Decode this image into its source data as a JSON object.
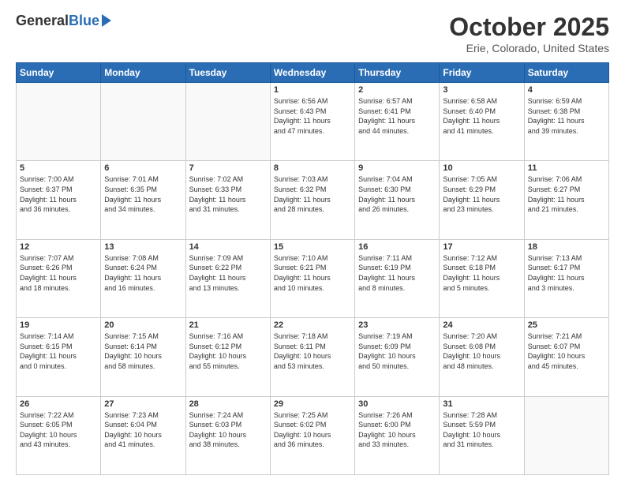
{
  "header": {
    "logo_general": "General",
    "logo_blue": "Blue",
    "month_title": "October 2025",
    "location": "Erie, Colorado, United States"
  },
  "days_of_week": [
    "Sunday",
    "Monday",
    "Tuesday",
    "Wednesday",
    "Thursday",
    "Friday",
    "Saturday"
  ],
  "weeks": [
    [
      {
        "day": "",
        "info": ""
      },
      {
        "day": "",
        "info": ""
      },
      {
        "day": "",
        "info": ""
      },
      {
        "day": "1",
        "info": "Sunrise: 6:56 AM\nSunset: 6:43 PM\nDaylight: 11 hours\nand 47 minutes."
      },
      {
        "day": "2",
        "info": "Sunrise: 6:57 AM\nSunset: 6:41 PM\nDaylight: 11 hours\nand 44 minutes."
      },
      {
        "day": "3",
        "info": "Sunrise: 6:58 AM\nSunset: 6:40 PM\nDaylight: 11 hours\nand 41 minutes."
      },
      {
        "day": "4",
        "info": "Sunrise: 6:59 AM\nSunset: 6:38 PM\nDaylight: 11 hours\nand 39 minutes."
      }
    ],
    [
      {
        "day": "5",
        "info": "Sunrise: 7:00 AM\nSunset: 6:37 PM\nDaylight: 11 hours\nand 36 minutes."
      },
      {
        "day": "6",
        "info": "Sunrise: 7:01 AM\nSunset: 6:35 PM\nDaylight: 11 hours\nand 34 minutes."
      },
      {
        "day": "7",
        "info": "Sunrise: 7:02 AM\nSunset: 6:33 PM\nDaylight: 11 hours\nand 31 minutes."
      },
      {
        "day": "8",
        "info": "Sunrise: 7:03 AM\nSunset: 6:32 PM\nDaylight: 11 hours\nand 28 minutes."
      },
      {
        "day": "9",
        "info": "Sunrise: 7:04 AM\nSunset: 6:30 PM\nDaylight: 11 hours\nand 26 minutes."
      },
      {
        "day": "10",
        "info": "Sunrise: 7:05 AM\nSunset: 6:29 PM\nDaylight: 11 hours\nand 23 minutes."
      },
      {
        "day": "11",
        "info": "Sunrise: 7:06 AM\nSunset: 6:27 PM\nDaylight: 11 hours\nand 21 minutes."
      }
    ],
    [
      {
        "day": "12",
        "info": "Sunrise: 7:07 AM\nSunset: 6:26 PM\nDaylight: 11 hours\nand 18 minutes."
      },
      {
        "day": "13",
        "info": "Sunrise: 7:08 AM\nSunset: 6:24 PM\nDaylight: 11 hours\nand 16 minutes."
      },
      {
        "day": "14",
        "info": "Sunrise: 7:09 AM\nSunset: 6:22 PM\nDaylight: 11 hours\nand 13 minutes."
      },
      {
        "day": "15",
        "info": "Sunrise: 7:10 AM\nSunset: 6:21 PM\nDaylight: 11 hours\nand 10 minutes."
      },
      {
        "day": "16",
        "info": "Sunrise: 7:11 AM\nSunset: 6:19 PM\nDaylight: 11 hours\nand 8 minutes."
      },
      {
        "day": "17",
        "info": "Sunrise: 7:12 AM\nSunset: 6:18 PM\nDaylight: 11 hours\nand 5 minutes."
      },
      {
        "day": "18",
        "info": "Sunrise: 7:13 AM\nSunset: 6:17 PM\nDaylight: 11 hours\nand 3 minutes."
      }
    ],
    [
      {
        "day": "19",
        "info": "Sunrise: 7:14 AM\nSunset: 6:15 PM\nDaylight: 11 hours\nand 0 minutes."
      },
      {
        "day": "20",
        "info": "Sunrise: 7:15 AM\nSunset: 6:14 PM\nDaylight: 10 hours\nand 58 minutes."
      },
      {
        "day": "21",
        "info": "Sunrise: 7:16 AM\nSunset: 6:12 PM\nDaylight: 10 hours\nand 55 minutes."
      },
      {
        "day": "22",
        "info": "Sunrise: 7:18 AM\nSunset: 6:11 PM\nDaylight: 10 hours\nand 53 minutes."
      },
      {
        "day": "23",
        "info": "Sunrise: 7:19 AM\nSunset: 6:09 PM\nDaylight: 10 hours\nand 50 minutes."
      },
      {
        "day": "24",
        "info": "Sunrise: 7:20 AM\nSunset: 6:08 PM\nDaylight: 10 hours\nand 48 minutes."
      },
      {
        "day": "25",
        "info": "Sunrise: 7:21 AM\nSunset: 6:07 PM\nDaylight: 10 hours\nand 45 minutes."
      }
    ],
    [
      {
        "day": "26",
        "info": "Sunrise: 7:22 AM\nSunset: 6:05 PM\nDaylight: 10 hours\nand 43 minutes."
      },
      {
        "day": "27",
        "info": "Sunrise: 7:23 AM\nSunset: 6:04 PM\nDaylight: 10 hours\nand 41 minutes."
      },
      {
        "day": "28",
        "info": "Sunrise: 7:24 AM\nSunset: 6:03 PM\nDaylight: 10 hours\nand 38 minutes."
      },
      {
        "day": "29",
        "info": "Sunrise: 7:25 AM\nSunset: 6:02 PM\nDaylight: 10 hours\nand 36 minutes."
      },
      {
        "day": "30",
        "info": "Sunrise: 7:26 AM\nSunset: 6:00 PM\nDaylight: 10 hours\nand 33 minutes."
      },
      {
        "day": "31",
        "info": "Sunrise: 7:28 AM\nSunset: 5:59 PM\nDaylight: 10 hours\nand 31 minutes."
      },
      {
        "day": "",
        "info": ""
      }
    ]
  ]
}
